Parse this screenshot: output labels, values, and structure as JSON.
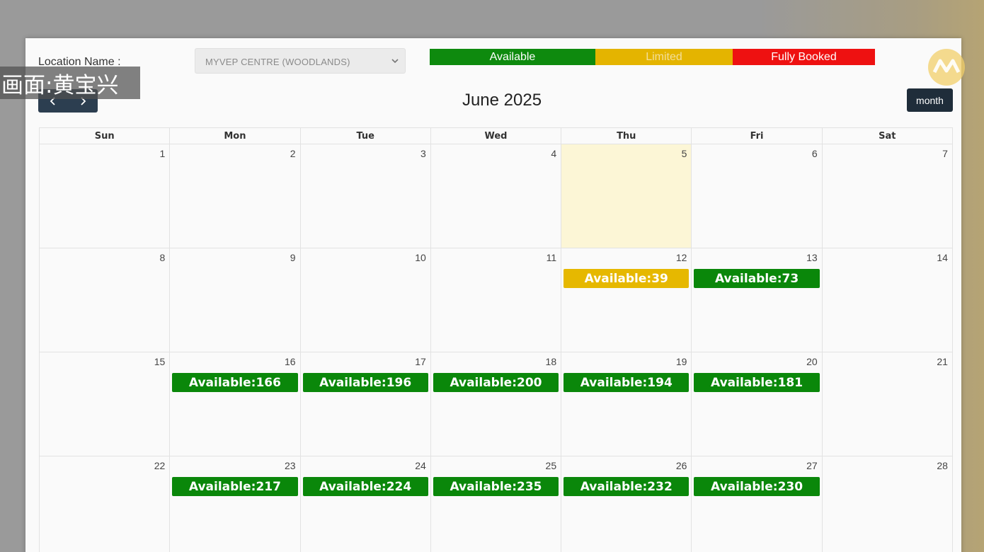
{
  "location": {
    "label": "Location Name :",
    "selected": "MYVEP CENTRE (WOODLANDS)"
  },
  "legend": {
    "available": "Available",
    "limited": "Limited",
    "fully_booked": "Fully Booked"
  },
  "colors": {
    "available": "#0a870a",
    "limited": "#e6b800",
    "fully_booked": "#ee1111",
    "today": "#fcf6d6",
    "nav": "#2c3e50"
  },
  "nav": {
    "prev_icon": "chevron-left-icon",
    "next_icon": "chevron-right-icon"
  },
  "calendar": {
    "title": "June 2025",
    "view_button": "month",
    "weekdays": [
      "Sun",
      "Mon",
      "Tue",
      "Wed",
      "Thu",
      "Fri",
      "Sat"
    ],
    "weeks": [
      [
        {
          "day": "1"
        },
        {
          "day": "2"
        },
        {
          "day": "3"
        },
        {
          "day": "4"
        },
        {
          "day": "5",
          "today": true
        },
        {
          "day": "6"
        },
        {
          "day": "7"
        }
      ],
      [
        {
          "day": "8"
        },
        {
          "day": "9"
        },
        {
          "day": "10"
        },
        {
          "day": "11"
        },
        {
          "day": "12",
          "event": "Available:39",
          "status": "limited"
        },
        {
          "day": "13",
          "event": "Available:73",
          "status": "available"
        },
        {
          "day": "14"
        }
      ],
      [
        {
          "day": "15"
        },
        {
          "day": "16",
          "event": "Available:166",
          "status": "available"
        },
        {
          "day": "17",
          "event": "Available:196",
          "status": "available"
        },
        {
          "day": "18",
          "event": "Available:200",
          "status": "available"
        },
        {
          "day": "19",
          "event": "Available:194",
          "status": "available"
        },
        {
          "day": "20",
          "event": "Available:181",
          "status": "available"
        },
        {
          "day": "21"
        }
      ],
      [
        {
          "day": "22"
        },
        {
          "day": "23",
          "event": "Available:217",
          "status": "available"
        },
        {
          "day": "24",
          "event": "Available:224",
          "status": "available"
        },
        {
          "day": "25",
          "event": "Available:235",
          "status": "available"
        },
        {
          "day": "26",
          "event": "Available:232",
          "status": "available"
        },
        {
          "day": "27",
          "event": "Available:230",
          "status": "available"
        },
        {
          "day": "28"
        }
      ]
    ]
  },
  "overlay": {
    "caption": "画面:黄宝兴"
  }
}
